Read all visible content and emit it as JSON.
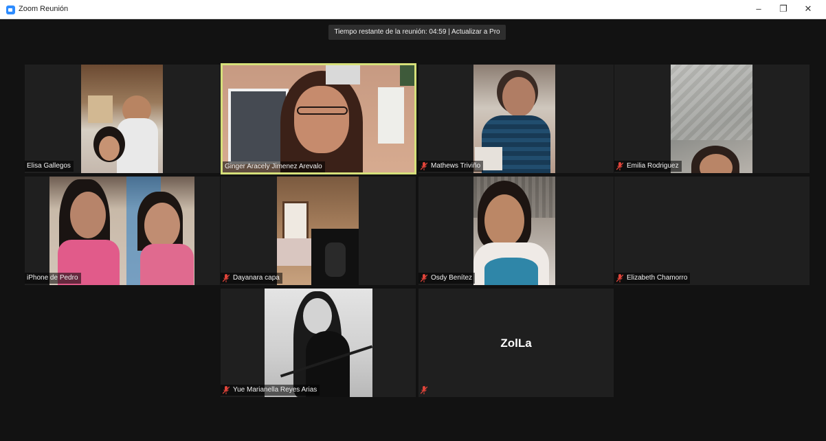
{
  "window": {
    "title": "Zoom Reunión",
    "controls": [
      "minimize",
      "restore",
      "close"
    ]
  },
  "banner": {
    "text": "Tiempo restante de la reunión: 04:59 | Actualizar a Pro"
  },
  "participants": [
    {
      "name": "Elisa Gallegos",
      "muted": false,
      "video": true
    },
    {
      "name": "Ginger Aracely Jimenez Arevalo",
      "muted": false,
      "video": true,
      "active_speaker": true
    },
    {
      "name": "Mathews Triviño",
      "muted": true,
      "video": true
    },
    {
      "name": "Emilia Rodriguez",
      "muted": true,
      "video": true
    },
    {
      "name": "iPhone de Pedro",
      "muted": false,
      "video": true
    },
    {
      "name": "Dayanara capa",
      "muted": true,
      "video": true
    },
    {
      "name": "Osdy Benítez",
      "muted": true,
      "video": true
    },
    {
      "name": "Elizabeth Chamorro",
      "muted": true,
      "video": false
    },
    {
      "name": "Yue Marianella Reyes Arias",
      "muted": true,
      "video": true
    },
    {
      "name": "",
      "display_text": "ZolLa",
      "muted": true,
      "video": false
    }
  ],
  "colors": {
    "background": "#121212",
    "tile": "#1f1f1f",
    "active_border": "#d6e07a",
    "muted_icon": "#e0443a"
  }
}
